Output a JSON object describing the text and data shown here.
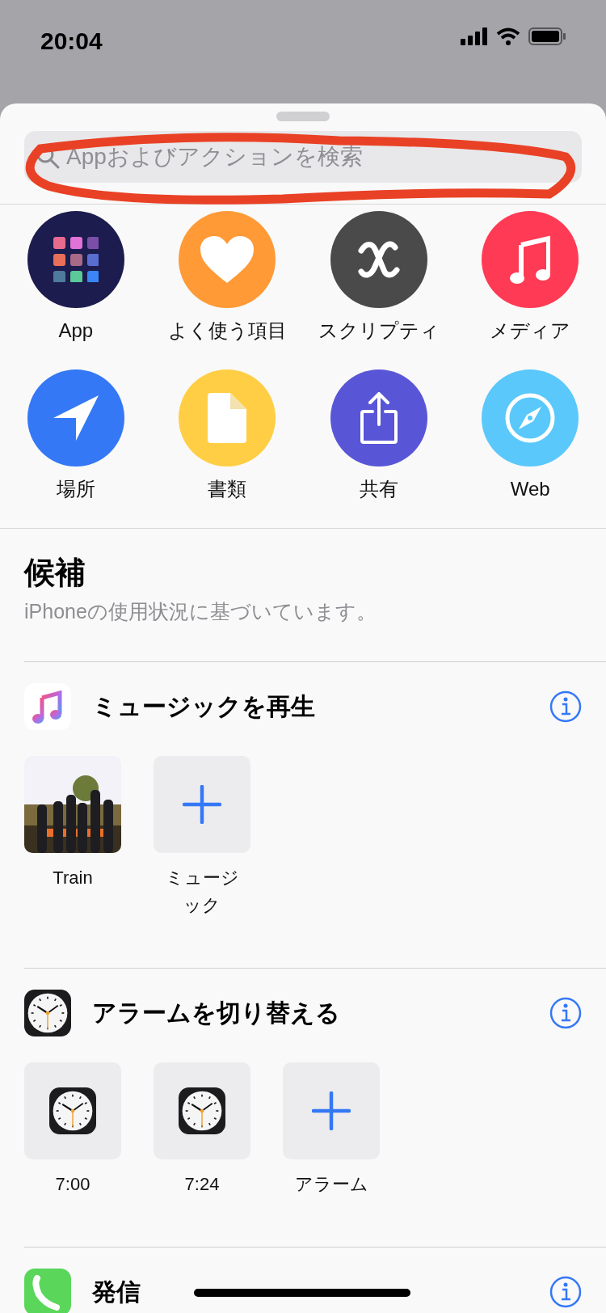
{
  "status_bar": {
    "time": "20:04"
  },
  "search": {
    "placeholder": "Appおよびアクションを検索"
  },
  "categories": [
    {
      "label": "App",
      "kind": "apps",
      "color": "#1c1c4e"
    },
    {
      "label": "よく使う項目",
      "kind": "heart",
      "color": "#ff9a37"
    },
    {
      "label": "スクリプティ",
      "kind": "script",
      "color": "#4a4a4a"
    },
    {
      "label": "メディア",
      "kind": "music",
      "color": "#ff3a54"
    },
    {
      "label": "場所",
      "kind": "location",
      "color": "#3478f6"
    },
    {
      "label": "書類",
      "kind": "document",
      "color": "#ffce44"
    },
    {
      "label": "共有",
      "kind": "share",
      "color": "#5856d6"
    },
    {
      "label": "Web",
      "kind": "compass",
      "color": "#5ac8fa"
    }
  ],
  "suggestions": {
    "title": "候補",
    "subtitle": "iPhoneの使用状況に基づいています。"
  },
  "sections": [
    {
      "title": "ミュージックを再生",
      "kind": "music",
      "items": [
        {
          "label": "Train",
          "kind": "picture"
        },
        {
          "label": "ミュージック",
          "kind": "add"
        }
      ]
    },
    {
      "title": "アラームを切り替える",
      "kind": "clock",
      "items": [
        {
          "label": "7:00",
          "kind": "clock"
        },
        {
          "label": "7:24",
          "kind": "clock"
        },
        {
          "label": "アラーム",
          "kind": "add"
        }
      ]
    },
    {
      "title": "発信",
      "kind": "phone"
    }
  ]
}
